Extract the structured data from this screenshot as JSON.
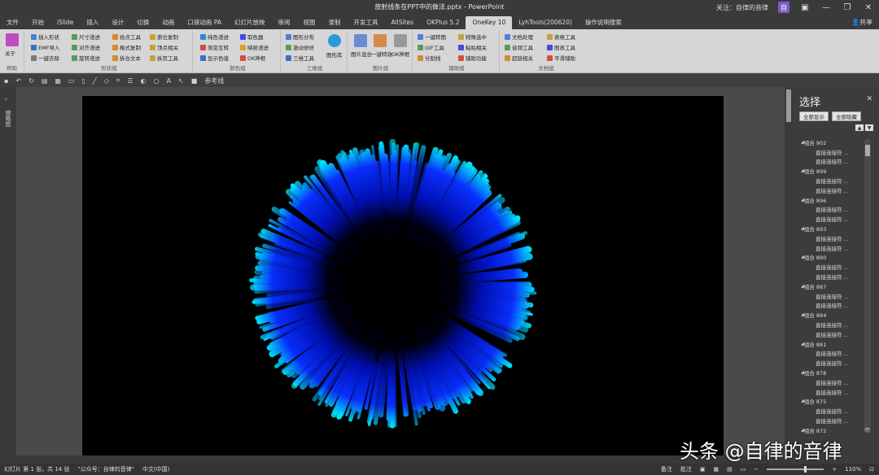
{
  "window": {
    "title": "放射线条在PPT中的做法.pptx - PowerPoint",
    "user_label": "关注：自律的音律",
    "share_label": "共享"
  },
  "menu": {
    "tabs": [
      "文件",
      "开始",
      "iSlide",
      "插入",
      "设计",
      "切换",
      "动画",
      "口袋动画 PA",
      "幻灯片放映",
      "审阅",
      "视图",
      "录制",
      "开发工具",
      "AllSites",
      "OKPlus 5.2",
      "OneKey 10",
      "LyhTools(200620)",
      "操作说明搜索"
    ],
    "active": "OneKey 10"
  },
  "ribbon": {
    "about": {
      "label": "关于",
      "group": "帮助"
    },
    "shape_group": {
      "label": "形状组",
      "items": [
        "插入形状",
        "尺寸递进",
        "拾点工具",
        "原位复制",
        "EMF导入",
        "对齐递进",
        "格式复制",
        "顶点相关",
        "一键去除",
        "旋转递进",
        "拆合文本",
        "拆页工具"
      ]
    },
    "color_group": {
      "label": "颜色组",
      "items": [
        "纯色递进",
        "取色器",
        "渐变互转",
        "映射递进",
        "显示色值",
        "OK神框"
      ]
    },
    "3d_group": {
      "label": "三维组",
      "items": [
        "图形分布",
        "激动修修",
        "三维工具",
        "图形库"
      ]
    },
    "image_group": {
      "label": "图片组",
      "items": [
        "图片混合",
        "一键特效",
        "OK神框"
      ]
    },
    "assist_group": {
      "label": "辅助组",
      "items": [
        "一键转图",
        "GIF工具",
        "分割线",
        "特殊选中",
        "粘贴相关",
        "辅助功能"
      ]
    },
    "doc_group": {
      "label": "文档组",
      "items": [
        "文档处理",
        "音频工具",
        "超链相关",
        "表格工具",
        "图表工具",
        "平滑辅助"
      ]
    }
  },
  "qat": {
    "items": [
      "save-icon",
      "undo-icon",
      "redo-icon",
      "format-icon",
      "pick-icon",
      "rect-icon",
      "textbox-icon",
      "line-icon",
      "shape-icon",
      "crop-icon",
      "align-icon",
      "fill-icon",
      "outline-icon",
      "font-icon",
      "cursor-icon"
    ],
    "reference_line_label": "参考线"
  },
  "left_panel": {
    "label": "缩略图"
  },
  "selection_pane": {
    "title": "选择",
    "show_all": "全部显示",
    "hide_all": "全部隐藏",
    "items": [
      {
        "name": "组合 902",
        "type": "group"
      },
      {
        "name": "直接连接符 ...",
        "type": "child"
      },
      {
        "name": "直接连接符 ...",
        "type": "child"
      },
      {
        "name": "组合 899",
        "type": "group"
      },
      {
        "name": "直接连接符 ...",
        "type": "child"
      },
      {
        "name": "直接连接符 ...",
        "type": "child"
      },
      {
        "name": "组合 896",
        "type": "group"
      },
      {
        "name": "直接连接符 ...",
        "type": "child"
      },
      {
        "name": "直接连接符 ...",
        "type": "child"
      },
      {
        "name": "组合 893",
        "type": "group"
      },
      {
        "name": "直接连接符 ...",
        "type": "child"
      },
      {
        "name": "直接连接符 ...",
        "type": "child"
      },
      {
        "name": "组合 890",
        "type": "group"
      },
      {
        "name": "直接连接符 ...",
        "type": "child"
      },
      {
        "name": "直接连接符 ...",
        "type": "child"
      },
      {
        "name": "组合 887",
        "type": "group"
      },
      {
        "name": "直接连接符 ...",
        "type": "child"
      },
      {
        "name": "直接连接符 ...",
        "type": "child"
      },
      {
        "name": "组合 884",
        "type": "group"
      },
      {
        "name": "直接连接符 ...",
        "type": "child"
      },
      {
        "name": "直接连接符 ...",
        "type": "child"
      },
      {
        "name": "组合 881",
        "type": "group"
      },
      {
        "name": "直接连接符 ...",
        "type": "child"
      },
      {
        "name": "直接连接符 ...",
        "type": "child"
      },
      {
        "name": "组合 878",
        "type": "group"
      },
      {
        "name": "直接连接符 ...",
        "type": "child"
      },
      {
        "name": "直接连接符 ...",
        "type": "child"
      },
      {
        "name": "组合 875",
        "type": "group"
      },
      {
        "name": "直接连接符 ...",
        "type": "child"
      },
      {
        "name": "直接连接符 ...",
        "type": "child"
      },
      {
        "name": "组合 872",
        "type": "group"
      }
    ]
  },
  "status": {
    "slide_info": "幻灯片 第 1 张，共 14 张",
    "account": "\"公众号：自律的音律\"",
    "language": "中文(中国)",
    "notes": "备注",
    "comments": "批注",
    "zoom": "110%"
  },
  "watermark": "头条 @自律的音律",
  "colors": {
    "ray_inner": "#0000ff",
    "ray_outer": "#00e5ff",
    "slide_bg": "#000000"
  }
}
